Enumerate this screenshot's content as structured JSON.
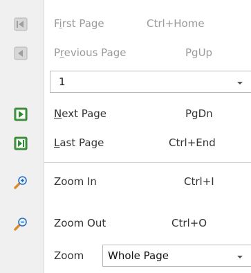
{
  "menu": {
    "first_page": {
      "label_pre": "F",
      "label_mnemonic": "i",
      "label_post": "rst Page",
      "shortcut": "Ctrl+Home",
      "icon": "first-page-icon",
      "enabled": false
    },
    "previous_page": {
      "label_pre": "P",
      "label_mnemonic": "r",
      "label_post": "evious Page",
      "shortcut": "PgUp",
      "icon": "previous-page-icon",
      "enabled": false
    },
    "page_select": {
      "value": "1"
    },
    "next_page": {
      "label_pre": "",
      "label_mnemonic": "N",
      "label_post": "ext Page",
      "shortcut": "PgDn",
      "icon": "next-page-icon",
      "enabled": true
    },
    "last_page": {
      "label_pre": "",
      "label_mnemonic": "L",
      "label_post": "ast Page",
      "shortcut": "Ctrl+End",
      "icon": "last-page-icon",
      "enabled": true
    },
    "zoom_in": {
      "label": "Zoom In",
      "shortcut": "Ctrl+I",
      "icon": "zoom-in-icon"
    },
    "zoom_out": {
      "label": "Zoom Out",
      "shortcut": "Ctrl+O",
      "icon": "zoom-out-icon"
    },
    "zoom": {
      "label": "Zoom",
      "value": "Whole Page"
    }
  },
  "colors": {
    "gutter": "#f0f0f0",
    "disabled_text": "#9a9a9a",
    "enabled_text": "#333333",
    "nav_icon_green": "#3f9a3f",
    "nav_icon_gray": "#b5b5b5"
  }
}
